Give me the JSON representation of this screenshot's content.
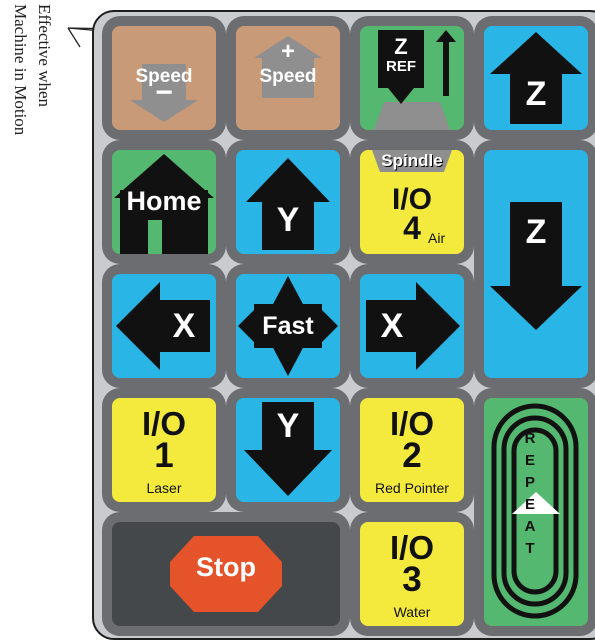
{
  "annotation": {
    "line1": "Effective when",
    "line2": "Machine in Motion"
  },
  "keys": {
    "speed_down": {
      "label": "Speed",
      "sign": "−"
    },
    "speed_up": {
      "label": "Speed",
      "sign": "+"
    },
    "z_ref": {
      "label_top": "Z",
      "label_bottom": "REF"
    },
    "z_up": {
      "label": "Z"
    },
    "home": {
      "label": "Home"
    },
    "y_up": {
      "label": "Y"
    },
    "spindle": {
      "label": "Spindle",
      "title": "I/O",
      "num": "4",
      "sub": "Air"
    },
    "z_down": {
      "label": "Z"
    },
    "x_left": {
      "label": "X"
    },
    "fast": {
      "label": "Fast"
    },
    "x_right": {
      "label": "X"
    },
    "io1": {
      "title": "I/O",
      "num": "1",
      "sub": "Laser"
    },
    "y_down": {
      "label": "Y"
    },
    "io2": {
      "title": "I/O",
      "num": "2",
      "sub": "Red Pointer"
    },
    "repeat": {
      "letters": [
        "R",
        "E",
        "P",
        "E",
        "A",
        "T"
      ]
    },
    "stop": {
      "label": "Stop"
    },
    "io3": {
      "title": "I/O",
      "num": "3",
      "sub": "Water"
    }
  },
  "colors": {
    "tan": "#c89a78",
    "blue": "#29b6e6",
    "green": "#55b870",
    "yellow": "#f3ea3d",
    "stop": "#e4532a",
    "key_frame": "#6b6d70",
    "pad": "#c9cbcf"
  }
}
